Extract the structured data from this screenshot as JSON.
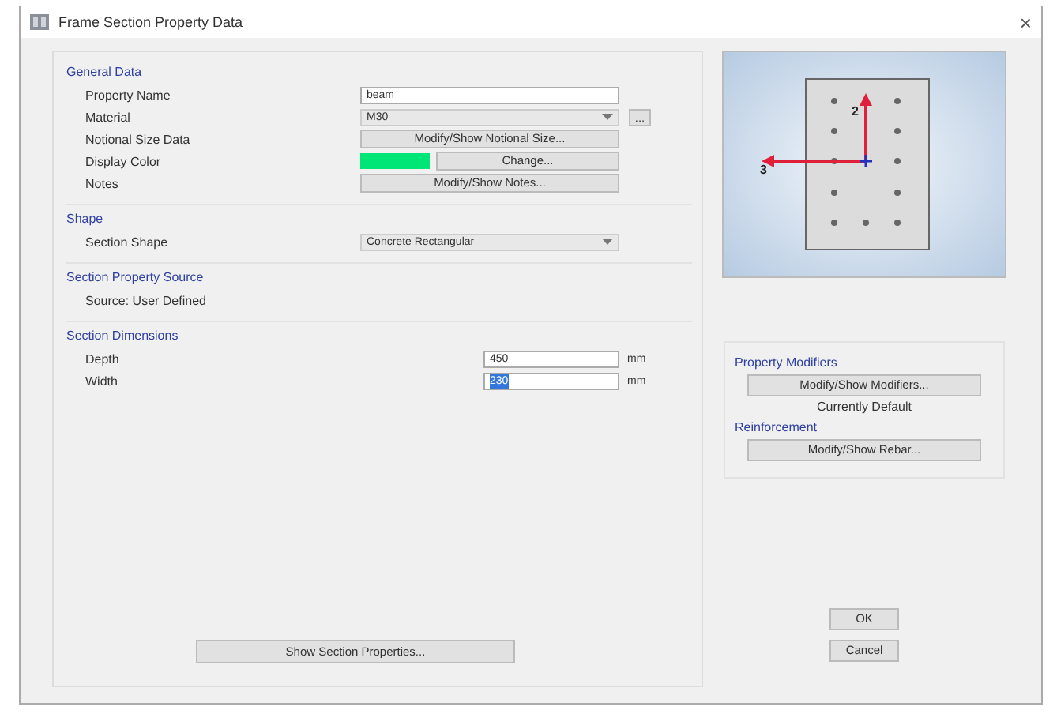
{
  "window": {
    "title": "Frame Section Property Data",
    "close": "×"
  },
  "general_data": {
    "heading": "General Data",
    "rows": [
      {
        "label": "Property Name",
        "kind": "text",
        "value": "beam"
      },
      {
        "label": "Material",
        "kind": "select",
        "value": "M30",
        "extra": "..."
      },
      {
        "label": "Notional Size Data",
        "kind": "button",
        "button": "Modify/Show Notional Size..."
      },
      {
        "label": "Display Color",
        "kind": "color",
        "color": "#00e676",
        "button": "Change..."
      },
      {
        "label": "Notes",
        "kind": "button",
        "button": "Modify/Show Notes..."
      }
    ]
  },
  "shape": {
    "heading": "Shape",
    "rows": [
      {
        "label": "Section Shape",
        "kind": "select",
        "value": "Concrete Rectangular"
      }
    ]
  },
  "property_source": {
    "heading": "Section Property Source",
    "text": "Source:  User Defined"
  },
  "dimensions": {
    "heading": "Section Dimensions",
    "rows": [
      {
        "label": "Depth",
        "value": "450",
        "unit": "mm",
        "selected": false
      },
      {
        "label": "Width",
        "value": "230",
        "unit": "mm",
        "selected": true
      }
    ]
  },
  "show_properties_button": "Show Section Properties...",
  "modifiers": {
    "heading": "Property Modifiers",
    "button": "Modify/Show Modifiers...",
    "status": "Currently Default"
  },
  "reinforcement": {
    "heading": "Reinforcement",
    "button": "Modify/Show Rebar..."
  },
  "preview": {
    "axis_labels": [
      "2",
      "3"
    ]
  },
  "buttons": [
    "OK",
    "Cancel"
  ]
}
